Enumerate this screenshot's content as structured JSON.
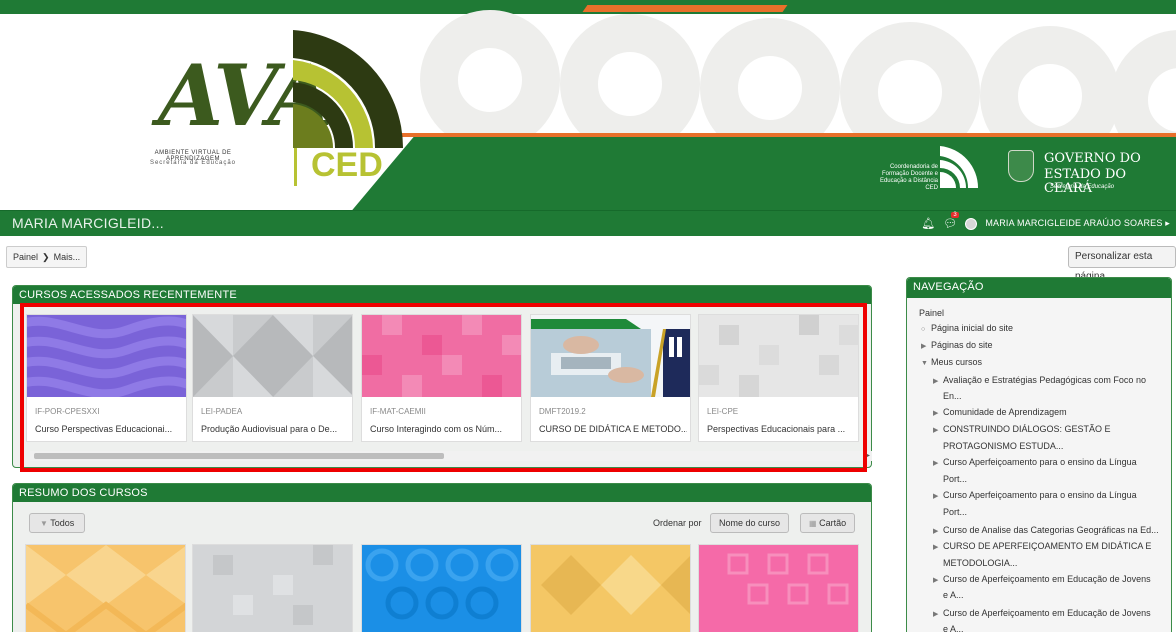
{
  "banner": {
    "logo_text": "AVA",
    "logo_subtitle_1": "AMBIENTE VIRTUAL DE APRENDIZAGEM",
    "logo_subtitle_2": "Secretaria da Educação",
    "logo_ced": "CED",
    "coord_line_1": "Coordenadoria de",
    "coord_line_2": "Formação Docente e",
    "coord_line_3": "Educação a Distância",
    "coord_line_4": "CED",
    "gov_line_1": "GOVERNO DO",
    "gov_line_2": "ESTADO DO CEARÁ",
    "gov_line_3": "Secretaria da Educação"
  },
  "navbar": {
    "user_short": "MARIA MARCIGLEID...",
    "user_full": "MARIA MARCIGLEIDE ARAÚJO SOARES",
    "message_badge": "3"
  },
  "breadcrumb": {
    "items": [
      "Painel",
      "Mais..."
    ]
  },
  "customize_button": "Personalizar esta página",
  "recent": {
    "title": "CURSOS ACESSADOS RECENTEMENTE",
    "courses": [
      {
        "code": "IF-POR-CPESXXI",
        "name": "Curso Perspectivas Educacionai...",
        "color": "#7a63d8"
      },
      {
        "code": "LEI-PADEA",
        "name": "Produção Audiovisual para o De...",
        "color": "#c9cbcd"
      },
      {
        "code": "IF-MAT-CAEMII",
        "name": "Curso Interagindo com os Núm...",
        "color": "#f06da3"
      },
      {
        "code": "DMFT2019.2",
        "name": "CURSO DE DIDÁTICA E METODO...",
        "color": "#8fb5c9"
      },
      {
        "code": "LEI-CPE",
        "name": "Perspectivas Educacionais para ...",
        "color": "#e6e6e6"
      }
    ]
  },
  "summary": {
    "title": "RESUMO DOS CURSOS",
    "filter_label": "Todos",
    "sort_label": "Ordenar por",
    "sort_value": "Nome do curso",
    "view_label": "Cartão",
    "card_colors": [
      "#f7c46c",
      "#d3d5d7",
      "#1b8fe6",
      "#f4c765",
      "#f56aa8"
    ]
  },
  "navigation": {
    "title": "NAVEGAÇÃO",
    "items": [
      {
        "label": "Painel",
        "indent": 0,
        "icon": ""
      },
      {
        "label": "Página inicial do site",
        "indent": 1,
        "icon": "dot"
      },
      {
        "label": "Páginas do site",
        "indent": 1,
        "icon": "right"
      },
      {
        "label": "Meus cursos",
        "indent": 1,
        "icon": "down"
      },
      {
        "label": "Avaliação e Estratégias Pedagógicas com Foco no",
        "indent": 2,
        "icon": "right"
      },
      {
        "label": "En...",
        "indent": 2,
        "icon": ""
      },
      {
        "label": "Comunidade de Aprendizagem",
        "indent": 2,
        "icon": "right"
      },
      {
        "label": "CONSTRUINDO DIÁLOGOS: GESTÃO E",
        "indent": 2,
        "icon": "right"
      },
      {
        "label": "PROTAGONISMO ESTUDA...",
        "indent": 2,
        "icon": ""
      },
      {
        "label": "Curso Aperfeiçoamento para o ensino da Língua",
        "indent": 2,
        "icon": "right"
      },
      {
        "label": "Port...",
        "indent": 2,
        "icon": ""
      },
      {
        "label": "Curso Aperfeiçoamento para o ensino da Língua",
        "indent": 2,
        "icon": "right"
      },
      {
        "label": "Port...",
        "indent": 2,
        "icon": ""
      },
      {
        "label": "Curso de Analise das Categorias Geográficas na Ed...",
        "indent": 2,
        "icon": "right"
      },
      {
        "label": "CURSO DE APERFEIÇOAMENTO EM DIDÁTICA E",
        "indent": 2,
        "icon": "right"
      },
      {
        "label": "METODOLOGIA...",
        "indent": 2,
        "icon": ""
      },
      {
        "label": "Curso de Aperfeiçoamento em Educação de Jovens",
        "indent": 2,
        "icon": "right"
      },
      {
        "label": "e A...",
        "indent": 2,
        "icon": ""
      },
      {
        "label": "Curso de Aperfeiçoamento em Educação de Jovens",
        "indent": 2,
        "icon": "right"
      },
      {
        "label": "e A...",
        "indent": 2,
        "icon": ""
      }
    ]
  }
}
